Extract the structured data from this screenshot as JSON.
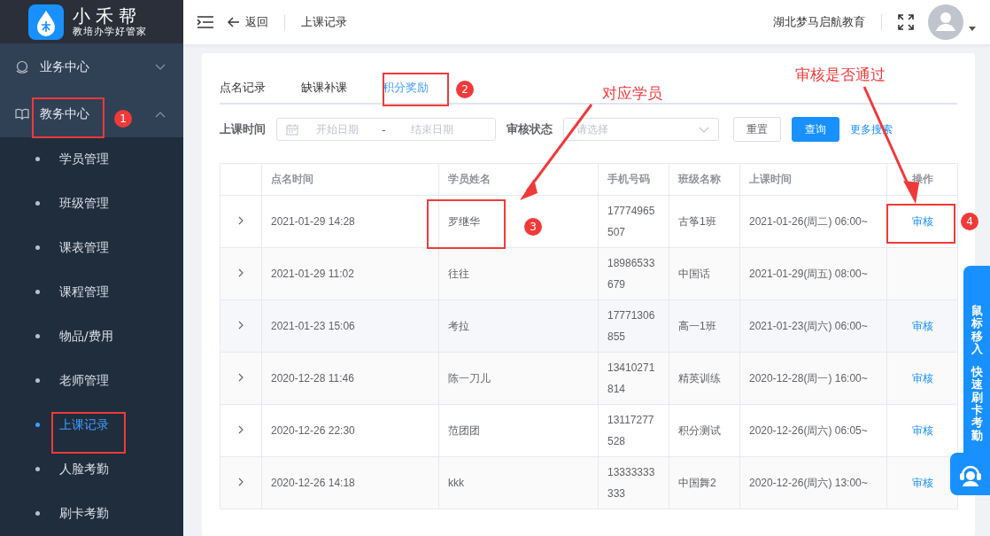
{
  "logo": {
    "title": "小禾帮",
    "slogan": "教培办学好管家"
  },
  "sidebar": {
    "groups": [
      {
        "label": "业务中心",
        "expanded": false
      },
      {
        "label": "教务中心",
        "expanded": true,
        "children": [
          {
            "label": "学员管理",
            "selected": false
          },
          {
            "label": "班级管理",
            "selected": false
          },
          {
            "label": "课表管理",
            "selected": false
          },
          {
            "label": "课程管理",
            "selected": false
          },
          {
            "label": "物品/费用",
            "selected": false
          },
          {
            "label": "老师管理",
            "selected": false
          },
          {
            "label": "上课记录",
            "selected": true
          },
          {
            "label": "人脸考勤",
            "selected": false
          },
          {
            "label": "刷卡考勤",
            "selected": false
          }
        ]
      }
    ]
  },
  "header": {
    "back": "返回",
    "breadcrumb": "上课记录",
    "org": "湖北梦马启航教育"
  },
  "tabs": [
    {
      "label": "点名记录",
      "selected": false
    },
    {
      "label": "缺课补课",
      "selected": false
    },
    {
      "label": "积分奖励",
      "selected": true
    }
  ],
  "filters": {
    "date_label": "上课时间",
    "start_placeholder": "开始日期",
    "separator": "-",
    "end_placeholder": "结束日期",
    "status_label": "审核状态",
    "status_placeholder": "请选择",
    "reset": "重置",
    "query": "查询",
    "more": "更多搜索"
  },
  "table": {
    "columns": [
      "点名时间",
      "学员姓名",
      "手机号码",
      "班级名称",
      "上课时间",
      "操作"
    ],
    "rows": [
      {
        "time": "2021-01-29 14:28",
        "name": "罗继华",
        "phone": [
          "17774965",
          "507"
        ],
        "class": "古筝1班",
        "lesson": "2021-01-26(周二) 06:00~",
        "action": "审核"
      },
      {
        "time": "2021-01-29 11:02",
        "name": "往往",
        "phone": [
          "18986533",
          "679"
        ],
        "class": "中国话",
        "lesson": "2021-01-29(周五) 08:00~",
        "action": ""
      },
      {
        "time": "2021-01-23 15:06",
        "name": "考拉",
        "phone": [
          "17771306",
          "855"
        ],
        "class": "高一1班",
        "lesson": "2021-01-23(周六) 06:00~",
        "action": "审核"
      },
      {
        "time": "2020-12-28 11:46",
        "name": "陈一刀儿",
        "phone": [
          "13410271",
          "814"
        ],
        "class": "精英训练",
        "lesson": "2020-12-28(周一) 16:00~",
        "action": "审核"
      },
      {
        "time": "2020-12-26 22:30",
        "name": "范团团",
        "phone": [
          "13117277",
          "528"
        ],
        "class": "积分测试",
        "lesson": "2020-12-26(周六) 06:05~",
        "action": "审核"
      },
      {
        "time": "2020-12-26 14:18",
        "name": "kkk",
        "phone": [
          "13333333",
          "333"
        ],
        "class": "中国舞2",
        "lesson": "2020-12-26(周六) 13:00~",
        "action": "审核"
      }
    ]
  },
  "float_panel": {
    "labels": [
      "鼠标移入",
      "快速刷卡考勤"
    ]
  },
  "annotations": {
    "labels": [
      "对应学员",
      "审核是否通过"
    ],
    "badges": [
      "1",
      "2",
      "3",
      "4"
    ]
  }
}
